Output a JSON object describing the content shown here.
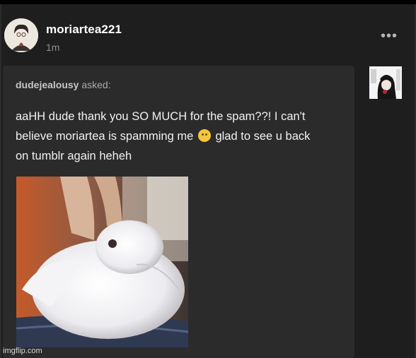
{
  "post": {
    "username": "moriartea221",
    "time": "1m",
    "more_label": "•••"
  },
  "ask": {
    "asker": "dudejealousy",
    "asked_label": "asked:",
    "line1": "aaHH dude thank you SO MUCH for the spam??! I can't",
    "line2_before": "believe moriartea is spamming me",
    "line2_after": "glad to see u back",
    "line3": "on tumblr again heheh",
    "emoji_icon": "pleading-face-emoji"
  },
  "watermark": "imgflip.com"
}
